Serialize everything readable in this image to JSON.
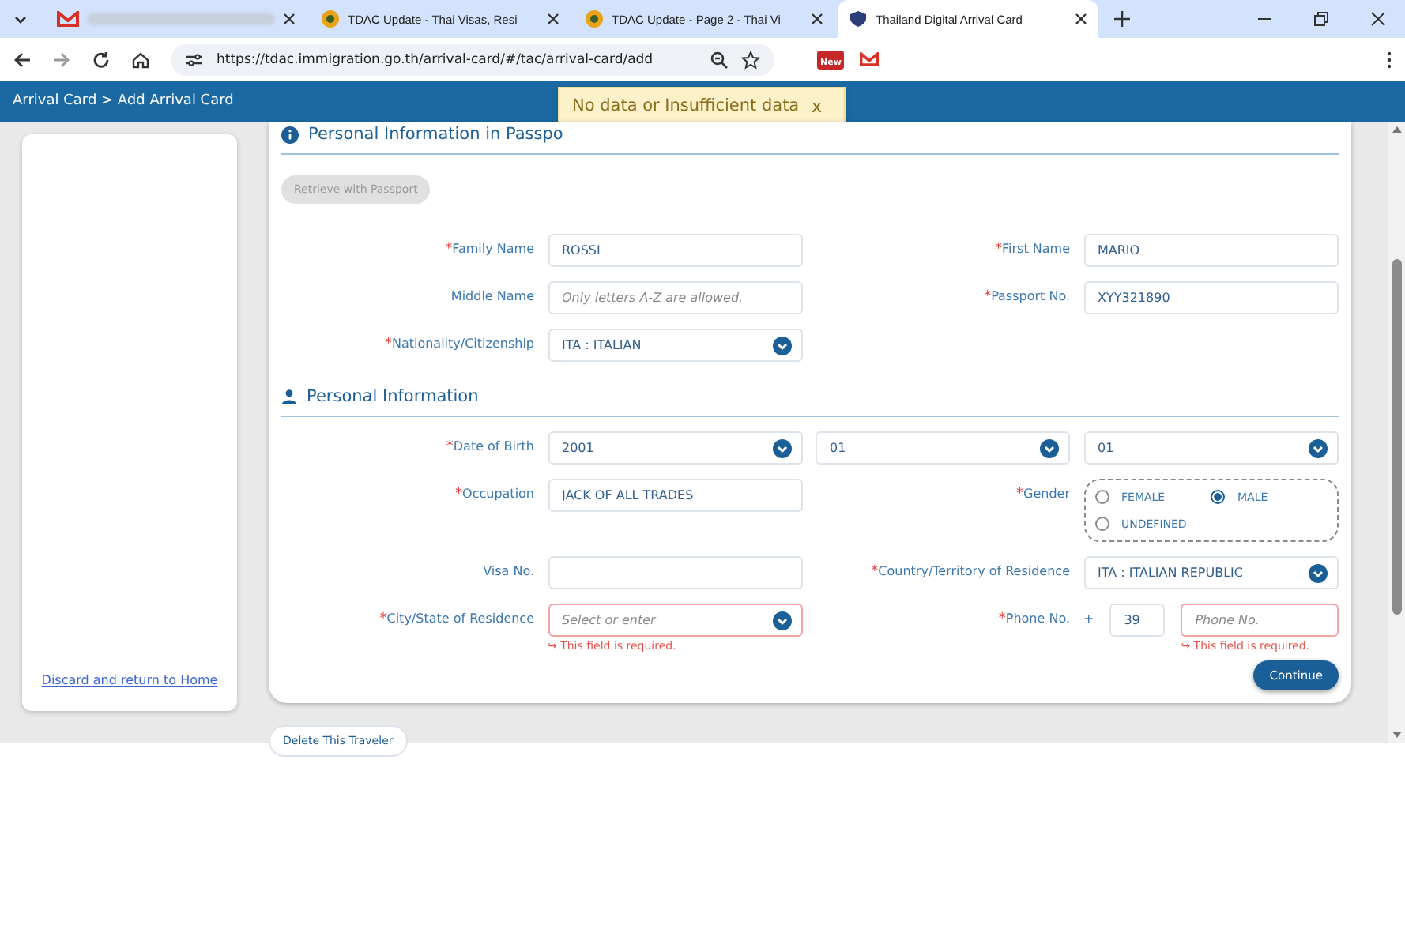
{
  "browser": {
    "tabs": [
      {
        "kind": "mail",
        "selected": false
      },
      {
        "kind": "site",
        "title": "TDAC Update - Thai Visas, Resi",
        "selected": false
      },
      {
        "kind": "site",
        "title": "TDAC Update - Page 2 - Thai Vi",
        "selected": false
      },
      {
        "kind": "shield",
        "title": "Thailand Digital Arrival Card",
        "selected": true
      }
    ],
    "url": "https://tdac.immigration.go.th/arrival-card/#/tac/arrival-card/add",
    "extension_badge": "New"
  },
  "header": {
    "breadcrumb": "Arrival Card > Add Arrival Card"
  },
  "toast": {
    "message": "No data or Insufficient data",
    "close": "x"
  },
  "sidebar": {
    "link": "Discard and return to Home"
  },
  "sections": [
    {
      "title": "Personal Information in Passpo",
      "button": "Retrieve with Passport",
      "rows": [
        [
          {
            "kind": "text",
            "label": "Family Name",
            "required_mark": "*",
            "value": "ROSSI"
          },
          {
            "kind": "text",
            "label": "First Name",
            "required_mark": "*",
            "value": "MARIO"
          }
        ],
        [
          {
            "kind": "text",
            "label": "Middle Name",
            "placeholder": "Only letters A-Z are allowed."
          },
          {
            "kind": "text",
            "label": "Passport No.",
            "required_mark": "*",
            "value": "XYY321890"
          }
        ],
        [
          {
            "kind": "select",
            "label": "Nationality/Citizenship",
            "required_mark": "*",
            "value": "ITA : ITALIAN"
          }
        ]
      ]
    },
    {
      "title": "Personal Information",
      "rows": [
        [
          {
            "kind": "date",
            "label": "Date of Birth",
            "required_mark": "*",
            "parts": [
              "2001",
              "01",
              "01"
            ]
          }
        ],
        [
          {
            "kind": "text",
            "label": "Occupation",
            "required_mark": "*",
            "value": "JACK OF ALL TRADES"
          },
          {
            "kind": "radio",
            "label": "Gender",
            "required_mark": "*",
            "options": [
              {
                "label": "FEMALE",
                "selected": false
              },
              {
                "label": "MALE",
                "selected": true
              },
              {
                "label": "UNDEFINED",
                "selected": false
              }
            ]
          }
        ],
        [
          {
            "kind": "text",
            "label": "Visa No."
          },
          {
            "kind": "select",
            "label": "Country/Territory of Residence",
            "required_mark": "*",
            "value": "ITA : ITALIAN REPUBLIC"
          }
        ],
        [
          {
            "kind": "select",
            "label": "City/State of Residence",
            "required_mark": "*",
            "placeholder": "Select or enter",
            "error": "↪ This field is required."
          },
          {
            "kind": "phone",
            "label": "Phone No.",
            "required_mark": "*",
            "prefix": "+",
            "code": "39",
            "placeholder": "Phone No.",
            "error": "↪ This field is required."
          }
        ]
      ]
    }
  ],
  "continue_button": "Continue",
  "delete_button": "Delete This Traveler"
}
